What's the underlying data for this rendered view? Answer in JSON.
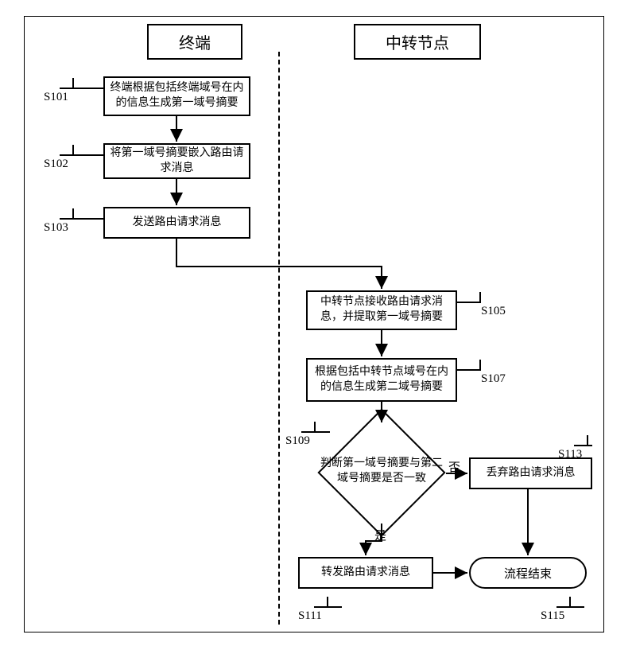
{
  "lanes": {
    "left_title": "终端",
    "right_title": "中转节点"
  },
  "steps": {
    "s101": {
      "tag": "S101",
      "text": "终端根据包括终端域号在内的信息生成第一域号摘要"
    },
    "s102": {
      "tag": "S102",
      "text": "将第一域号摘要嵌入路由请求消息"
    },
    "s103": {
      "tag": "S103",
      "text": "发送路由请求消息"
    },
    "s105": {
      "tag": "S105",
      "text": "中转节点接收路由请求消息，并提取第一域号摘要"
    },
    "s107": {
      "tag": "S107",
      "text": "根据包括中转节点域号在内的信息生成第二域号摘要"
    },
    "s109": {
      "tag": "S109",
      "text": "判断第一域号摘要与第二域号摘要是否一致"
    },
    "s111": {
      "tag": "S111",
      "text": "转发路由请求消息"
    },
    "s113": {
      "tag": "S113",
      "text": "丢弃路由请求消息"
    },
    "s115": {
      "tag": "S115",
      "text": "流程结束"
    }
  },
  "decision_labels": {
    "yes": "是",
    "no": "否"
  },
  "chart_data": {
    "type": "flowchart",
    "swimlanes": [
      "终端",
      "中转节点"
    ],
    "nodes": [
      {
        "id": "S101",
        "lane": "终端",
        "shape": "process",
        "text": "终端根据包括终端域号在内的信息生成第一域号摘要"
      },
      {
        "id": "S102",
        "lane": "终端",
        "shape": "process",
        "text": "将第一域号摘要嵌入路由请求消息"
      },
      {
        "id": "S103",
        "lane": "终端",
        "shape": "process",
        "text": "发送路由请求消息"
      },
      {
        "id": "S105",
        "lane": "中转节点",
        "shape": "process",
        "text": "中转节点接收路由请求消息，并提取第一域号摘要"
      },
      {
        "id": "S107",
        "lane": "中转节点",
        "shape": "process",
        "text": "根据包括中转节点域号在内的信息生成第二域号摘要"
      },
      {
        "id": "S109",
        "lane": "中转节点",
        "shape": "decision",
        "text": "判断第一域号摘要与第二域号摘要是否一致"
      },
      {
        "id": "S111",
        "lane": "中转节点",
        "shape": "process",
        "text": "转发路由请求消息"
      },
      {
        "id": "S113",
        "lane": "中转节点",
        "shape": "process",
        "text": "丢弃路由请求消息"
      },
      {
        "id": "S115",
        "lane": "中转节点",
        "shape": "terminator",
        "text": "流程结束"
      }
    ],
    "edges": [
      {
        "from": "S101",
        "to": "S102"
      },
      {
        "from": "S102",
        "to": "S103"
      },
      {
        "from": "S103",
        "to": "S105"
      },
      {
        "from": "S105",
        "to": "S107"
      },
      {
        "from": "S107",
        "to": "S109"
      },
      {
        "from": "S109",
        "to": "S111",
        "label": "是"
      },
      {
        "from": "S109",
        "to": "S113",
        "label": "否"
      },
      {
        "from": "S111",
        "to": "S115"
      },
      {
        "from": "S113",
        "to": "S115"
      }
    ]
  }
}
